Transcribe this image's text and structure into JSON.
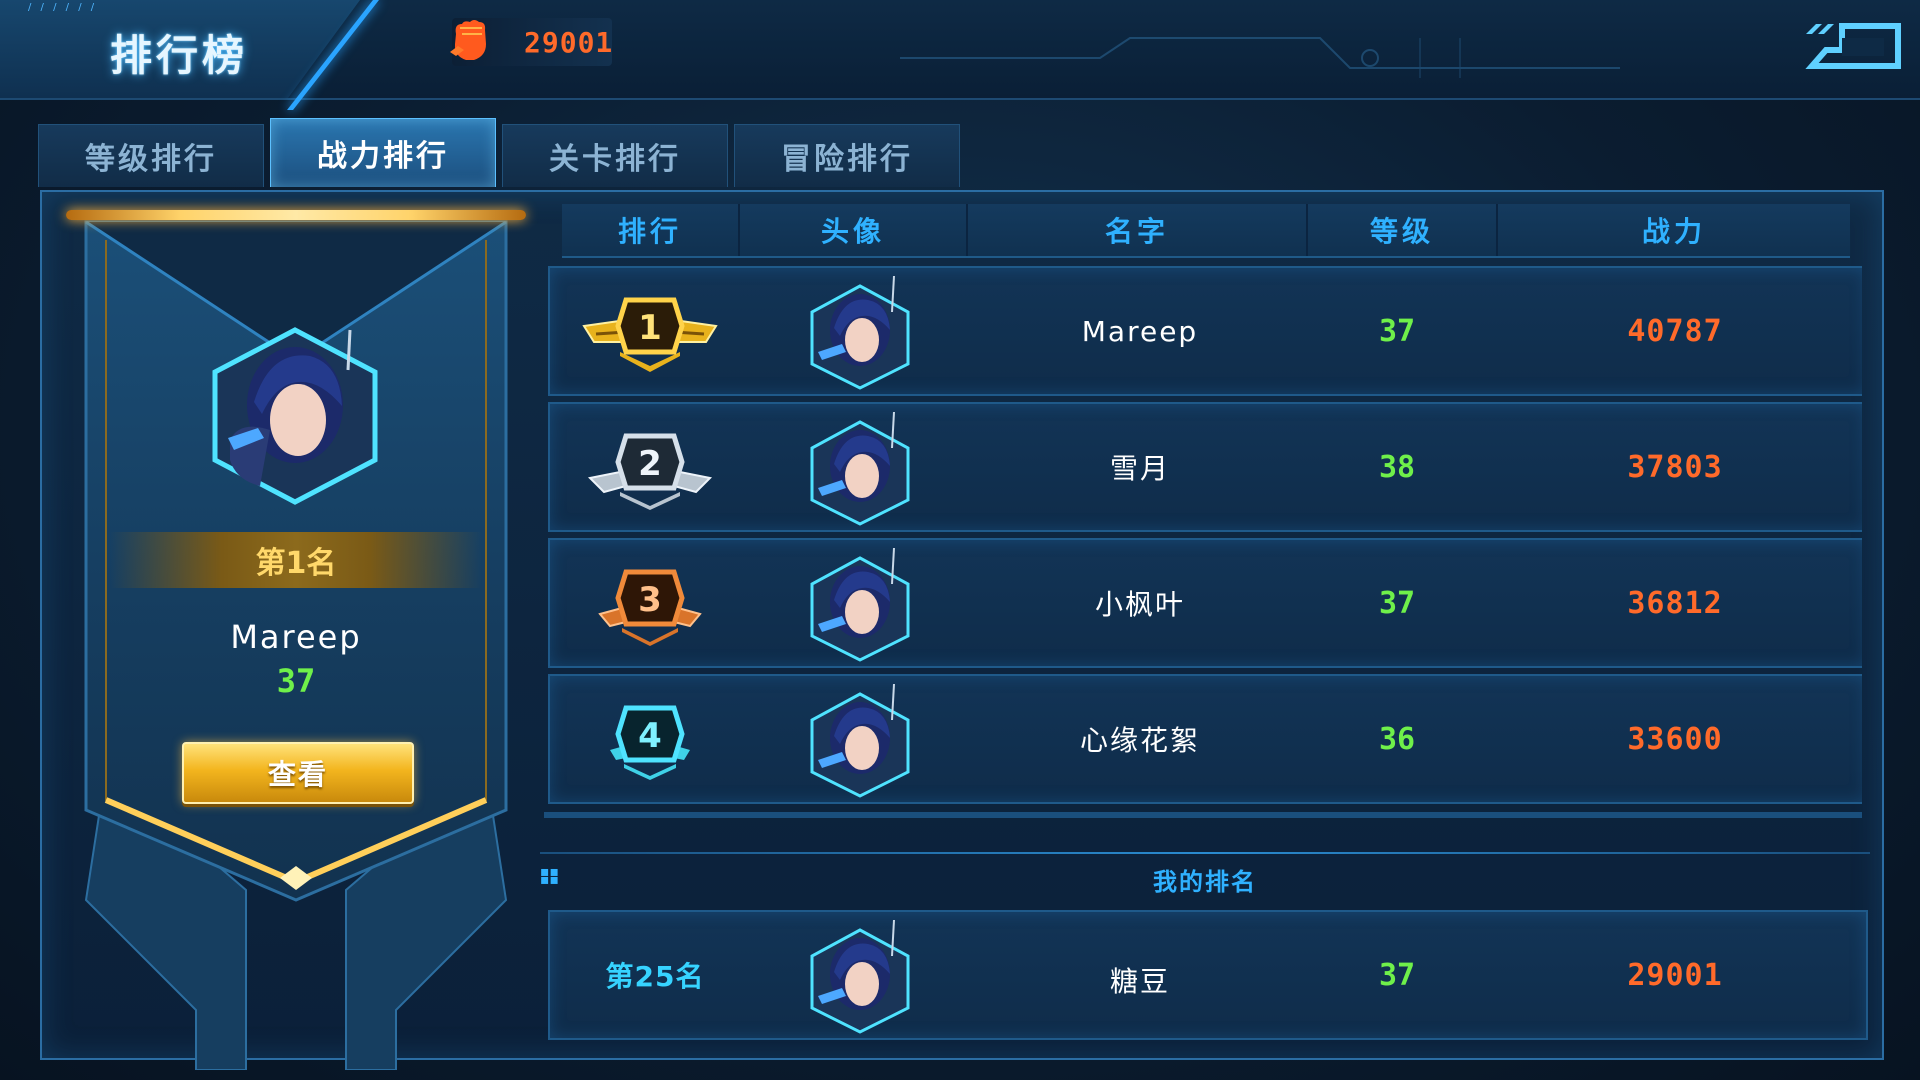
{
  "header": {
    "title": "排行榜",
    "power_value": "29001",
    "back_icon": "back-arrow-icon"
  },
  "tabs": [
    {
      "label": "等级排行",
      "active": false
    },
    {
      "label": "战力排行",
      "active": true
    },
    {
      "label": "关卡排行",
      "active": false
    },
    {
      "label": "冒险排行",
      "active": false
    }
  ],
  "table": {
    "columns": [
      "排行",
      "头像",
      "名字",
      "等级",
      "战力"
    ],
    "rows": [
      {
        "rank": "1",
        "name": "Mareep",
        "level": "37",
        "power": "40787",
        "badge_color": "#e8b21c"
      },
      {
        "rank": "2",
        "name": "雪月",
        "level": "38",
        "power": "37803",
        "badge_color": "#b8c4cf"
      },
      {
        "rank": "3",
        "name": "小枫叶",
        "level": "37",
        "power": "36812",
        "badge_color": "#d9742a"
      },
      {
        "rank": "4",
        "name": "心缘花絮",
        "level": "36",
        "power": "33600",
        "badge_color": "#3fd2e8"
      }
    ]
  },
  "champion": {
    "rank_label": "第1名",
    "name": "Mareep",
    "level": "37",
    "view_button": "查看"
  },
  "my_rank": {
    "title": "我的排名",
    "rank_label": "第25名",
    "name": "糖豆",
    "level": "37",
    "power": "29001"
  },
  "colors": {
    "accent_blue": "#2fb1ff",
    "level_green": "#6ff04a",
    "power_orange": "#ff6a2a",
    "gold": "#ffd86a"
  }
}
